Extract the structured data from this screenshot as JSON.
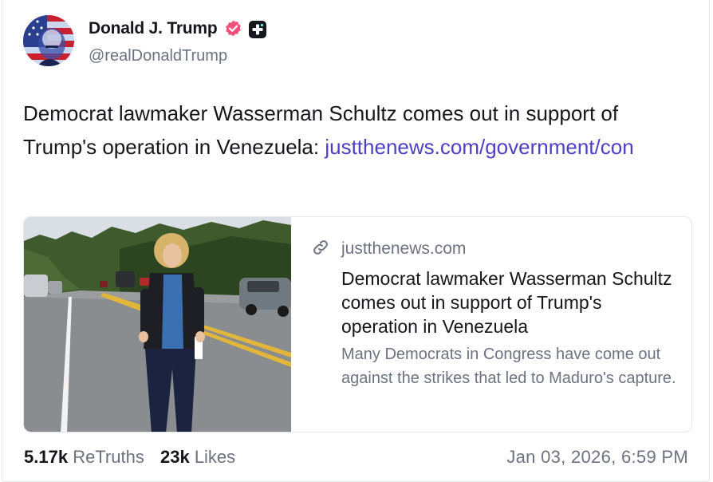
{
  "post": {
    "author": {
      "display_name": "Donald J. Trump",
      "handle": "@realDonaldTrump",
      "verified_icon": "verified-badge-icon",
      "badge_icon": "truth-plus-icon"
    },
    "text": "Democrat lawmaker Wasserman Schultz comes out in support of Trump's operation in Venezuela: ",
    "link_text": "justthenews.com/government/con",
    "preview": {
      "domain": "justthenews.com",
      "title": "Democrat lawmaker Wasserman Schultz comes out in support of Trump's operation in Venezuela",
      "description": "Many Democrats in Congress have come out against the strikes that led to Maduro's capture.",
      "icon": "link-icon"
    },
    "stats": {
      "retruths_count": "5.17k",
      "retruths_label": "ReTruths",
      "likes_count": "23k",
      "likes_label": "Likes"
    },
    "timestamp": "Jan 03, 2026, 6:59 PM"
  },
  "colors": {
    "link": "#4d3fc6",
    "verified": "#f0507a",
    "muted_text": "#6b7280",
    "primary_text": "#16161d"
  }
}
